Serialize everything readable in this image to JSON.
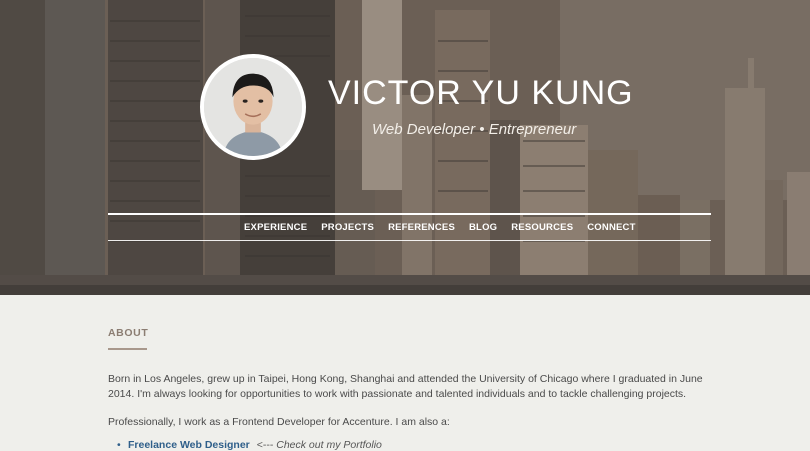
{
  "header": {
    "name": "VICTOR YU KUNG",
    "tagline": "Web Developer • Entrepreneur"
  },
  "nav": {
    "items": [
      {
        "label": "EXPERIENCE"
      },
      {
        "label": "PROJECTS"
      },
      {
        "label": "REFERENCES"
      },
      {
        "label": "BLOG"
      },
      {
        "label": "RESOURCES"
      },
      {
        "label": "CONNECT"
      }
    ]
  },
  "about": {
    "title": "ABOUT",
    "paragraph1": "Born in Los Angeles, grew up in Taipei, Hong Kong, Shanghai and attended the University of Chicago where I graduated in June 2014. I'm always looking for opportunities to work with passionate and talented individuals and to tackle challenging projects.",
    "paragraph2": "Professionally, I work as a Frontend Developer for Accenture. I am also a:",
    "list": [
      {
        "link": "Freelance Web Designer",
        "arrow": "<---",
        "note": "Check out my Portfolio"
      }
    ]
  },
  "colors": {
    "link": "#2f5f8a",
    "section_title": "#8b7d72",
    "page_background": "#efefeb"
  },
  "icons": {
    "avatar": "profile-photo"
  }
}
